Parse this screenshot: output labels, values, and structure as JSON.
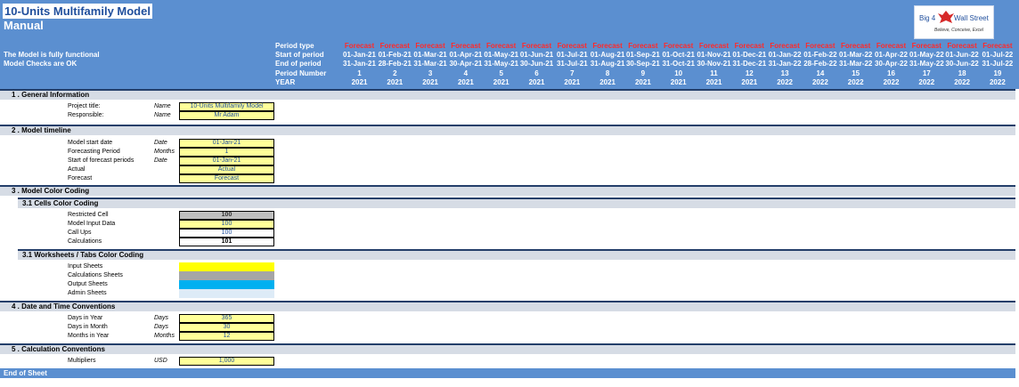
{
  "header": {
    "title": "10-Units Multifamily Model",
    "subtitle": "Manual",
    "status_line1": "The Model is fully functional",
    "status_line2": "Model Checks are OK",
    "logo": {
      "big": "Big 4",
      "ws": "Wall Street",
      "tagline": "Believe, Conceive, Excel"
    },
    "row_labels": [
      "Period type",
      "Start of period",
      "End of period",
      "Period Number",
      "YEAR"
    ]
  },
  "periods": [
    {
      "type": "Forecast",
      "start": "01-Jan-21",
      "end": "31-Jan-21",
      "num": "1",
      "year": "2021"
    },
    {
      "type": "Forecast",
      "start": "01-Feb-21",
      "end": "28-Feb-21",
      "num": "2",
      "year": "2021"
    },
    {
      "type": "Forecast",
      "start": "01-Mar-21",
      "end": "31-Mar-21",
      "num": "3",
      "year": "2021"
    },
    {
      "type": "Forecast",
      "start": "01-Apr-21",
      "end": "30-Apr-21",
      "num": "4",
      "year": "2021"
    },
    {
      "type": "Forecast",
      "start": "01-May-21",
      "end": "31-May-21",
      "num": "5",
      "year": "2021"
    },
    {
      "type": "Forecast",
      "start": "01-Jun-21",
      "end": "30-Jun-21",
      "num": "6",
      "year": "2021"
    },
    {
      "type": "Forecast",
      "start": "01-Jul-21",
      "end": "31-Jul-21",
      "num": "7",
      "year": "2021"
    },
    {
      "type": "Forecast",
      "start": "01-Aug-21",
      "end": "31-Aug-21",
      "num": "8",
      "year": "2021"
    },
    {
      "type": "Forecast",
      "start": "01-Sep-21",
      "end": "30-Sep-21",
      "num": "9",
      "year": "2021"
    },
    {
      "type": "Forecast",
      "start": "01-Oct-21",
      "end": "31-Oct-21",
      "num": "10",
      "year": "2021"
    },
    {
      "type": "Forecast",
      "start": "01-Nov-21",
      "end": "30-Nov-21",
      "num": "11",
      "year": "2021"
    },
    {
      "type": "Forecast",
      "start": "01-Dec-21",
      "end": "31-Dec-21",
      "num": "12",
      "year": "2021"
    },
    {
      "type": "Forecast",
      "start": "01-Jan-22",
      "end": "31-Jan-22",
      "num": "13",
      "year": "2022"
    },
    {
      "type": "Forecast",
      "start": "01-Feb-22",
      "end": "28-Feb-22",
      "num": "14",
      "year": "2022"
    },
    {
      "type": "Forecast",
      "start": "01-Mar-22",
      "end": "31-Mar-22",
      "num": "15",
      "year": "2022"
    },
    {
      "type": "Forecast",
      "start": "01-Apr-22",
      "end": "30-Apr-22",
      "num": "16",
      "year": "2022"
    },
    {
      "type": "Forecast",
      "start": "01-May-22",
      "end": "31-May-22",
      "num": "17",
      "year": "2022"
    },
    {
      "type": "Forecast",
      "start": "01-Jun-22",
      "end": "30-Jun-22",
      "num": "18",
      "year": "2022"
    },
    {
      "type": "Forecast",
      "start": "01-Jul-22",
      "end": "31-Jul-22",
      "num": "19",
      "year": "2022"
    }
  ],
  "sections": {
    "s1": "1 . General Information",
    "s2": "2 . Model timeline",
    "s3": "3 . Model Color Coding",
    "s31": "3.1 Cells Color Coding",
    "s31b": "3.1 Worksheets / Tabs Color Coding",
    "s4": "4 . Date and Time Conventions",
    "s5": "5 . Calculation Conventions"
  },
  "general": {
    "project_label": "Project title:",
    "project_unit": "Name",
    "project_value": "10-Units Multifamily Model",
    "resp_label": "Responsible:",
    "resp_unit": "Name",
    "resp_value": "Mr Adam"
  },
  "timeline": [
    {
      "label": "Model start date",
      "unit": "Date",
      "value": "01-Jan-21"
    },
    {
      "label": "Forecasting Period",
      "unit": "Months",
      "value": "1"
    },
    {
      "label": "Start of forecast periods",
      "unit": "Date",
      "value": "01-Jan-21"
    },
    {
      "label": "Actual",
      "unit": "",
      "value": "Actual"
    },
    {
      "label": "Forecast",
      "unit": "",
      "value": "Forecast"
    }
  ],
  "cells_coding": [
    {
      "label": "Restricted Cell",
      "value": "100",
      "color": "#bfbfbf"
    },
    {
      "label": "Model Input Data",
      "value": "100",
      "color": "#ffff99"
    },
    {
      "label": "Call Ups",
      "value": "100",
      "color": "#ffffff"
    },
    {
      "label": "Calculations",
      "value": "101",
      "color": "#ffffff"
    }
  ],
  "tabs_coding": [
    {
      "label": "Input Sheets",
      "color": "#ffff00"
    },
    {
      "label": "Calculations Sheets",
      "color": "#a6a6a6"
    },
    {
      "label": "Output Sheets",
      "color": "#00b0f0"
    },
    {
      "label": "Admin Sheets",
      "color": "#ddebf7"
    }
  ],
  "date_time": [
    {
      "label": "Days in Year",
      "unit": "Days",
      "value": "365"
    },
    {
      "label": "Days in Month",
      "unit": "Days",
      "value": "30"
    },
    {
      "label": "Months in Year",
      "unit": "Months",
      "value": "12"
    }
  ],
  "calc": {
    "label": "Multipliers",
    "unit": "USD",
    "value": "1,000"
  },
  "footer": "End of Sheet"
}
